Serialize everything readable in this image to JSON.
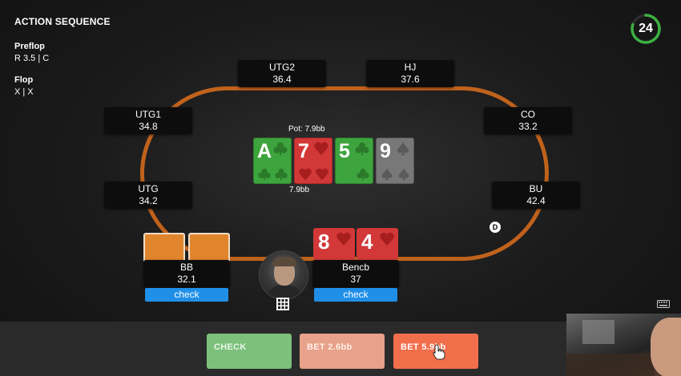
{
  "action_sequence": {
    "title": "ACTION SEQUENCE",
    "streets": [
      {
        "name": "Preflop",
        "actions": "R 3.5  |  C"
      },
      {
        "name": "Flop",
        "actions": "X  |  X"
      }
    ]
  },
  "timer": {
    "value": "24",
    "fraction_remaining": 0.8,
    "color": "#3cb043"
  },
  "pot": {
    "label": "Pot: 7.9bb",
    "center_amount": "7.9bb"
  },
  "seats": {
    "utg2": {
      "position": "UTG2",
      "stack": "36.4"
    },
    "hj": {
      "position": "HJ",
      "stack": "37.6"
    },
    "utg1": {
      "position": "UTG1",
      "stack": "34.8"
    },
    "co": {
      "position": "CO",
      "stack": "33.2"
    },
    "utg": {
      "position": "UTG",
      "stack": "34.2"
    },
    "bu": {
      "position": "BU",
      "stack": "42.4"
    },
    "bb": {
      "position": "BB",
      "stack": "32.1",
      "action": "check"
    },
    "hero": {
      "position": "Bencb",
      "stack": "37",
      "action": "check"
    }
  },
  "board": [
    {
      "rank": "A",
      "suit": "club",
      "color": "green"
    },
    {
      "rank": "7",
      "suit": "heart",
      "color": "red"
    },
    {
      "rank": "5",
      "suit": "club",
      "color": "green"
    },
    {
      "rank": "9",
      "suit": "spade",
      "color": "grey"
    }
  ],
  "hero_cards": [
    {
      "rank": "8",
      "suit": "heart"
    },
    {
      "rank": "4",
      "suit": "heart"
    }
  ],
  "dealer_button": "D",
  "actions": {
    "check": "CHECK",
    "bet_small": "BET 2.6bb",
    "bet_large": "BET 5.9bb"
  },
  "colors": {
    "rail": "#c0621c",
    "check_badge": "#1f8fe8",
    "green_card": "#3ea53e",
    "red_card": "#d23838",
    "grey_card": "#787878"
  }
}
